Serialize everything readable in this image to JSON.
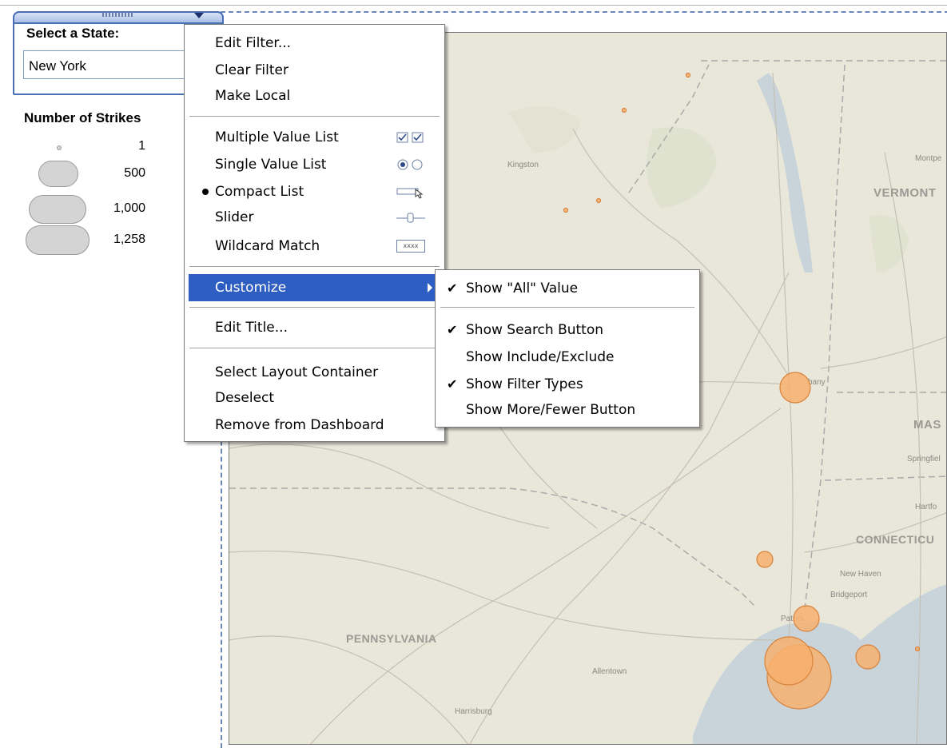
{
  "filter": {
    "title": "Select a State:",
    "selected_value": "New York"
  },
  "legend": {
    "title": "Number of Strikes",
    "items": [
      {
        "label": "1",
        "value": 1
      },
      {
        "label": "500",
        "value": 500
      },
      {
        "label": "1,000",
        "value": 1000
      },
      {
        "label": "1,258",
        "value": 1258
      }
    ],
    "bubble_color": "#d4d4d4"
  },
  "map": {
    "state_labels": [
      "VERMONT",
      "MAS",
      "CONNECTICU",
      "PENNSYLVANIA"
    ],
    "city_labels": [
      "Kingston",
      "Montpe",
      "bany",
      "Springfiel",
      "Hartfo",
      "New Haven",
      "Bridgeport",
      "Paters",
      "Allentown",
      "Harrisburg"
    ],
    "marker_color": "#f7b06f",
    "marker_stroke": "#d9823a"
  },
  "context_menu": {
    "items": [
      {
        "label": "Edit Filter..."
      },
      {
        "label": "Clear Filter"
      },
      {
        "label": "Make Local"
      },
      {
        "label": "Multiple Value List",
        "icon": "multi-checkbox-icon"
      },
      {
        "label": "Single Value List",
        "icon": "radio-buttons-icon"
      },
      {
        "label": "Compact List",
        "icon": "compact-list-icon",
        "selected": true
      },
      {
        "label": "Slider",
        "icon": "slider-icon"
      },
      {
        "label": "Wildcard Match",
        "icon": "wildcard-icon",
        "icon_text": "xxxx"
      },
      {
        "label": "Customize",
        "highlighted": true,
        "has_submenu": true
      },
      {
        "label": "Edit Title..."
      },
      {
        "label": "Select Layout Container"
      },
      {
        "label": "Deselect"
      },
      {
        "label": "Remove from Dashboard"
      }
    ],
    "highlight_color": "#2f5ec2"
  },
  "customize_submenu": {
    "items": [
      {
        "label": "Show \"All\" Value",
        "checked": true
      },
      {
        "label": "Show Search Button",
        "checked": true
      },
      {
        "label": "Show Include/Exclude",
        "checked": false
      },
      {
        "label": "Show Filter Types",
        "checked": true
      },
      {
        "label": "Show More/Fewer Button",
        "checked": false
      }
    ]
  }
}
